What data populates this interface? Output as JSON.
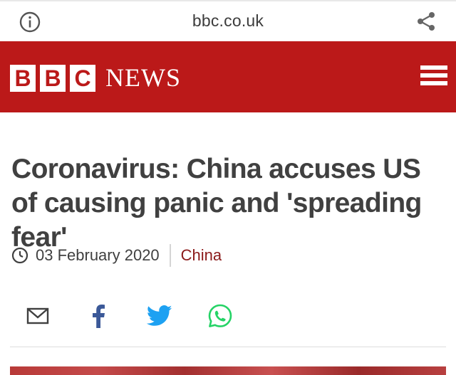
{
  "browser": {
    "url": "bbc.co.uk"
  },
  "masthead": {
    "logo_letters": [
      "B",
      "B",
      "C"
    ],
    "logo_word": "NEWS"
  },
  "article": {
    "headline": "Coronavirus: China accuses US of causing panic and 'spreading fear'",
    "date": "03 February 2020",
    "tag": "China"
  },
  "share": {
    "icons": [
      "mail-icon",
      "facebook-icon",
      "twitter-icon",
      "whatsapp-icon"
    ]
  },
  "colors": {
    "brand_red": "#bb1919",
    "tag_red": "#8b1a1a",
    "facebook_blue": "#3b5998",
    "twitter_blue": "#1da1f2",
    "whatsapp_green": "#25d366"
  }
}
